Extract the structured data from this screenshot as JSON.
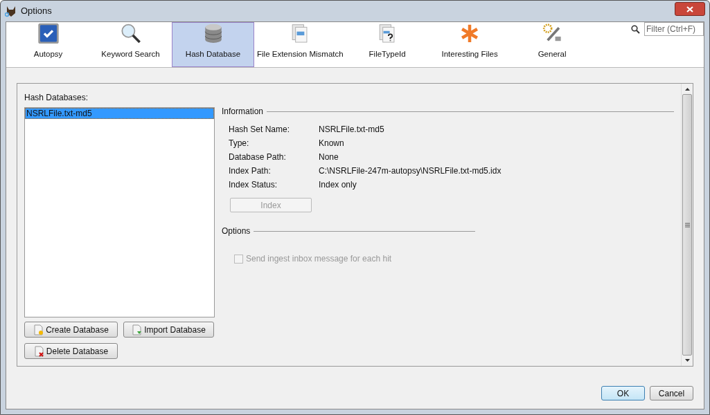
{
  "window": {
    "title": "Options"
  },
  "tabs": [
    {
      "label": "Autopsy",
      "selected": false
    },
    {
      "label": "Keyword Search",
      "selected": false
    },
    {
      "label": "Hash Database",
      "selected": true
    },
    {
      "label": "File Extension Mismatch",
      "selected": false
    },
    {
      "label": "FileTypeId",
      "selected": false
    },
    {
      "label": "Interesting Files",
      "selected": false
    },
    {
      "label": "General",
      "selected": false
    }
  ],
  "filter": {
    "placeholder": "Filter (Ctrl+F)"
  },
  "hash_databases": {
    "label": "Hash Databases:",
    "items": [
      {
        "name": "NSRLFile.txt-md5",
        "selected": true
      }
    ],
    "buttons": [
      {
        "label": "Create Database",
        "kind": "create"
      },
      {
        "label": "Import Database",
        "kind": "import"
      },
      {
        "label": "Delete Database",
        "kind": "delete"
      }
    ]
  },
  "information": {
    "title": "Information",
    "rows": [
      {
        "label": "Hash Set Name:",
        "value": "NSRLFile.txt-md5"
      },
      {
        "label": "Type:",
        "value": "Known"
      },
      {
        "label": "Database Path:",
        "value": "None"
      },
      {
        "label": "Index Path:",
        "value": "C:\\NSRLFile-247m-autopsy\\NSRLFile.txt-md5.idx"
      },
      {
        "label": "Index Status:",
        "value": "Index only"
      }
    ],
    "index_button": {
      "label": "Index",
      "disabled": true
    }
  },
  "options": {
    "title": "Options",
    "checkbox": {
      "label": "Send ingest inbox message for each hit",
      "checked": false,
      "disabled": true
    }
  },
  "footer_buttons": [
    "OK",
    "Cancel"
  ]
}
